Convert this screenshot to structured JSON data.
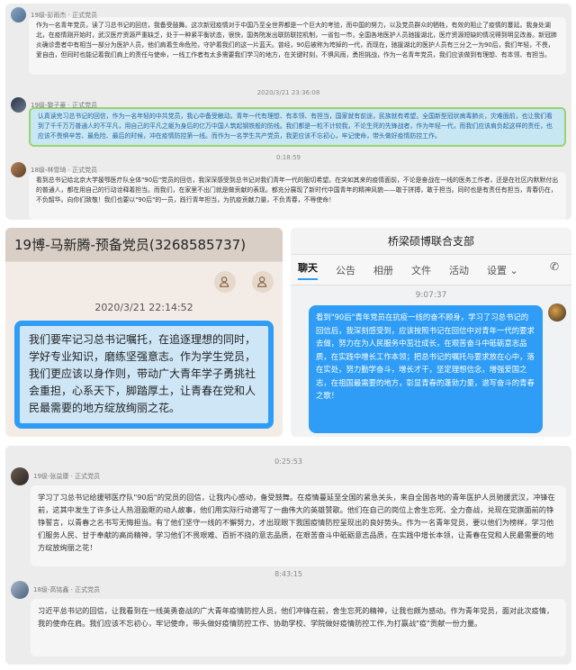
{
  "panel1": {
    "msg1": {
      "sender": "19级-彭雨杰 · 正式党员",
      "text": "作为一名青年党员，读了习总书记的回信，我备受鼓舞。这次新冠疫情对于中国乃至全世界都是一个巨大的考验，而中国的努力，以及党员群众的牺牲，有效的阻止了疫情的蔓延。我身处湖北，在疫情刚开始时，武汉医疗资源严重缺乏，处于一种紧平衡状态，很快，国务院发出联防联控机制，一省包一市，全国各地医护人员驰援湖北，医疗资源短缺的情况得到明显改善。新冠肺炎确诊患者中有相当一部分为医护人员，他们肩着生命危险，守护着我们的这一片蓝天。曾经，90后被称为垮掉的一代，而现在，驰援湖北的医护人员有三分之一为90后，我们年轻，不畏，爱自由，但同时也能记着我们肩上的责任与使命，一线工作者有太多需要我们学习的地方，在关键时刻，不惧风雨，勇担挑战，作为一名青年党员，我们应该做到有理想、有本领、有担当。"
    },
    "ts1": "2020/3/21 23:36:08",
    "msg2": {
      "sender": "19级-黎子豪 · 正式党员",
      "text": "认真读完习总书记的回信，作为一名年轻的中共党员，我心中备受触动。青年一代有理想、有本领、有担当，国家就有前途，民族就有希望。全国新型冠状病毒肺炎，灾难面前，也让我们看到了千千万万普通人的不平凡，用自己的平凡之躯为身后的亿万中国人筑起钢铁般的防线。我们都是一粒不计较我，不论生死的先锋战者，作为年轻一代，而我们应该肩负起这样的责任，也应该不畏惧辛苦、最危险、最后的时候，冲在疫情防控第一线。而作为一名学生共产党员，我更应该不忘初心，牢记使命，带头做好疫情防控工作。"
    },
    "ts2": "0:18:59",
    "msg3": {
      "sender": "18级-林雪琦 · 正式党员",
      "text": "看到总书记给北京大学援鄂医疗队全体\"90后\"党员的回信，我深深感受到总书记对我们青年一代的殷切希望。在突如其来的疫情面前，不论是奋战在一线的医务工作者，还是在社区内默默付出的普通人，都在用自己的行动诠释着担当。而我们，在家里不出门就是做贡献的表现。都充分展现了新时代中国青年的精神风貌——敢于拼搏，敢于担当。同时也是有责任有担当，青春仍在，不负韶华。向你们致敬！我们也要以\"90后\"的一员，践行青年担当，为抗疫贡献力量，不负青春，不辱使命！"
    }
  },
  "panel2": {
    "title": "19博-马新腾-预备党员(3268585737)",
    "time": "2020/3/21 22:14:52",
    "text": "我们要牢记习总书记嘱托，在追逐理想的同时，学好专业知识，磨练坚强意志。作为学生党员，我们更应该以身作则，带动广大青年学子勇挑社会重担，心系天下，脚踏厚土，让青春在党和人民最需要的地方绽放绚丽之花。"
  },
  "panel3": {
    "title": "桥梁硕博联合支部",
    "tabs": [
      "聊天",
      "公告",
      "相册",
      "文件",
      "活动",
      "设置 ⌄"
    ],
    "time": "9:07:37",
    "text": "看到\"90后\"青年党员在抗疫一线的奋不顾身，学习了习总书记的回信后，我深刻感受到，应该按照书记在回信中对青年一代的要求去做，努力在为人民服务中茁壮成长，在艰苦奋斗中砥砺意志品质，在实践中增长工作本领；把总书记的嘱托与要求放在心中，落在实处，努力勤学奋斗，增长才干，坚定理想信念，增强爱国之志，在祖国最需要的地方，彰显青春的蓬勃力量，谱写奋斗的青春之歌！"
  },
  "panel4": {
    "ts1": "0:25:53",
    "msg1": {
      "sender": "19级-张益康 · 正式党员",
      "text": "学习了习总书记给援鄂医疗队\"90后\"的党员的回信，让我内心感动，备受鼓舞。在疫情蔓延至全国的紧急关头，来自全国各地的青年医护人员驰援武汉，冲锋在前，这其中发生了许多让人热泪盈眶的动人故事，他们用实际行动谱写了一曲伟大的英雄赞歌。他们在自己的岗位上舍生忘死、全力奋战，兑现在党旗面前的铮铮誓言，以青春之名书写无悔担当。有了他们坚守一线的不懈努力，才出现眼下我国疫情防控呈现出的良好势头。作为一名青年党员，要以他们为榜样，学习他们服务人民、甘于奉献的高尚精神，学习他们不畏艰难、百折不挠的意志品质，在艰苦奋斗中砥砺意志品质，在实践中增长本领，让青春在党和人民最需要的地方绽放绚丽之花！"
    },
    "ts2": "8:43:15",
    "msg2": {
      "sender": "18级-高铭鑫 · 正式党员",
      "text": "习近平总书记的回信，让我看到在一线英勇奋战的广大青年疫情防控人员，他们冲锋在前，舍生忘死的精神，让我也颇为感动。作为青年党员，面对此次疫情，我的使命在肩。我们应该不忘初心，牢记使命，带头做好疫情防控工作、协助学校、学院做好疫情防控工作,为打赢战\"疫\"贡献一份力量。"
    }
  }
}
